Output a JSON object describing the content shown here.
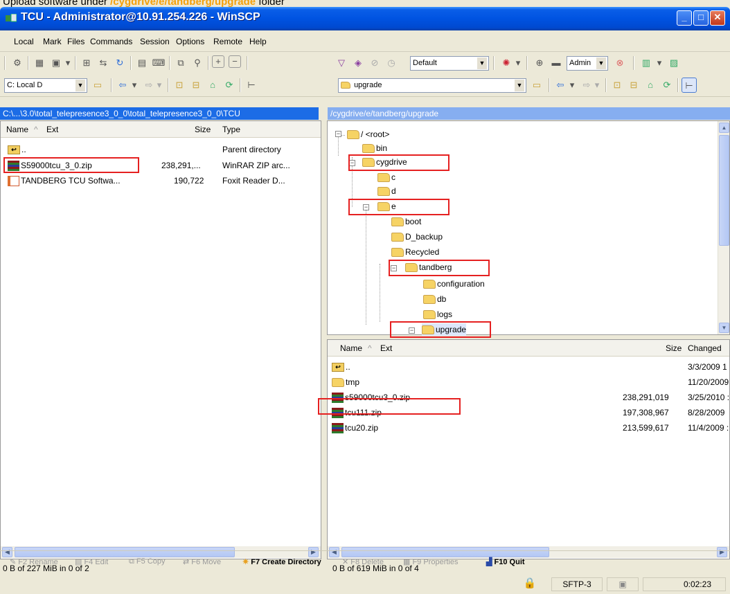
{
  "caption": {
    "prefix": "Upload software under ",
    "path": "/cygdrive/e/tandberg/upgrade",
    "suffix": " folder"
  },
  "window": {
    "title": "TCU - Administrator@10.91.254.226 - WinSCP"
  },
  "menu": [
    "Local",
    "Mark",
    "Files",
    "Commands",
    "Session",
    "Options",
    "Remote",
    "Help"
  ],
  "toolbar": {
    "transfer_setting": "Default",
    "profile": "Admin"
  },
  "local": {
    "drive": "C: Local D",
    "path": "C:\\...\\3.0\\total_telepresence3_0_0\\total_telepresence3_0_0\\TCU",
    "columns": {
      "name": "Name",
      "ext": "Ext",
      "size": "Size",
      "type": "Type"
    },
    "rows": [
      {
        "name": "..",
        "size": "",
        "type": "Parent directory",
        "icon": "up-dir-icon"
      },
      {
        "name": "S59000tcu_3_0.zip",
        "size": "238,291,...",
        "type": "WinRAR ZIP arc...",
        "icon": "rar-archive-icon"
      },
      {
        "name": "TANDBERG TCU Softwa...",
        "size": "190,722",
        "type": "Foxit Reader D...",
        "icon": "pdf-icon"
      }
    ],
    "status": "0 B of 227 MiB in 0 of 2"
  },
  "remote": {
    "dir": "upgrade",
    "path": "/cygdrive/e/tandberg/upgrade",
    "tree": [
      {
        "label": "/ <root>",
        "depth": 0,
        "exp": "-"
      },
      {
        "label": "bin",
        "depth": 1,
        "exp": ""
      },
      {
        "label": "cygdrive",
        "depth": 1,
        "exp": "-"
      },
      {
        "label": "c",
        "depth": 2,
        "exp": ""
      },
      {
        "label": "d",
        "depth": 2,
        "exp": ""
      },
      {
        "label": "e",
        "depth": 2,
        "exp": "-"
      },
      {
        "label": "boot",
        "depth": 3,
        "exp": ""
      },
      {
        "label": "D_backup",
        "depth": 3,
        "exp": ""
      },
      {
        "label": "Recycled",
        "depth": 3,
        "exp": ""
      },
      {
        "label": "tandberg",
        "depth": 3,
        "exp": "-"
      },
      {
        "label": "configuration",
        "depth": 4,
        "exp": ""
      },
      {
        "label": "db",
        "depth": 4,
        "exp": ""
      },
      {
        "label": "logs",
        "depth": 4,
        "exp": ""
      },
      {
        "label": "upgrade",
        "depth": 4,
        "exp": "-"
      }
    ],
    "columns": {
      "name": "Name",
      "ext": "Ext",
      "size": "Size",
      "changed": "Changed"
    },
    "rows": [
      {
        "name": "..",
        "size": "",
        "changed": "3/3/2009 1",
        "icon": "up-dir-icon"
      },
      {
        "name": "tmp",
        "size": "",
        "changed": "11/20/2009",
        "icon": "folder-icon"
      },
      {
        "name": "s59000tcu3_0.zip",
        "size": "238,291,019",
        "changed": "3/25/2010 :",
        "icon": "rar-archive-icon"
      },
      {
        "name": "tcu111.zip",
        "size": "197,308,967",
        "changed": "8/28/2009",
        "icon": "rar-archive-icon"
      },
      {
        "name": "tcu20.zip",
        "size": "213,599,617",
        "changed": "11/4/2009 :",
        "icon": "rar-archive-icon"
      }
    ],
    "status": "0 B of 619 MiB in 0 of 4"
  },
  "fkeys": [
    {
      "label": "F2 Rename",
      "enabled": false
    },
    {
      "label": "F4 Edit",
      "enabled": false
    },
    {
      "label": "F5 Copy",
      "enabled": false
    },
    {
      "label": "F6 Move",
      "enabled": false
    },
    {
      "label": "F7 Create Directory",
      "enabled": true
    },
    {
      "label": "F8 Delete",
      "enabled": false
    },
    {
      "label": "F9 Properties",
      "enabled": false
    },
    {
      "label": "F10 Quit",
      "enabled": true
    }
  ],
  "statusbar": {
    "protocol": "SFTP-3",
    "elapsed": "0:02:23"
  },
  "colors": {
    "title_blue": "#0053e1",
    "highlight_red": "#e52020",
    "caption_orange": "#f5a00a"
  }
}
